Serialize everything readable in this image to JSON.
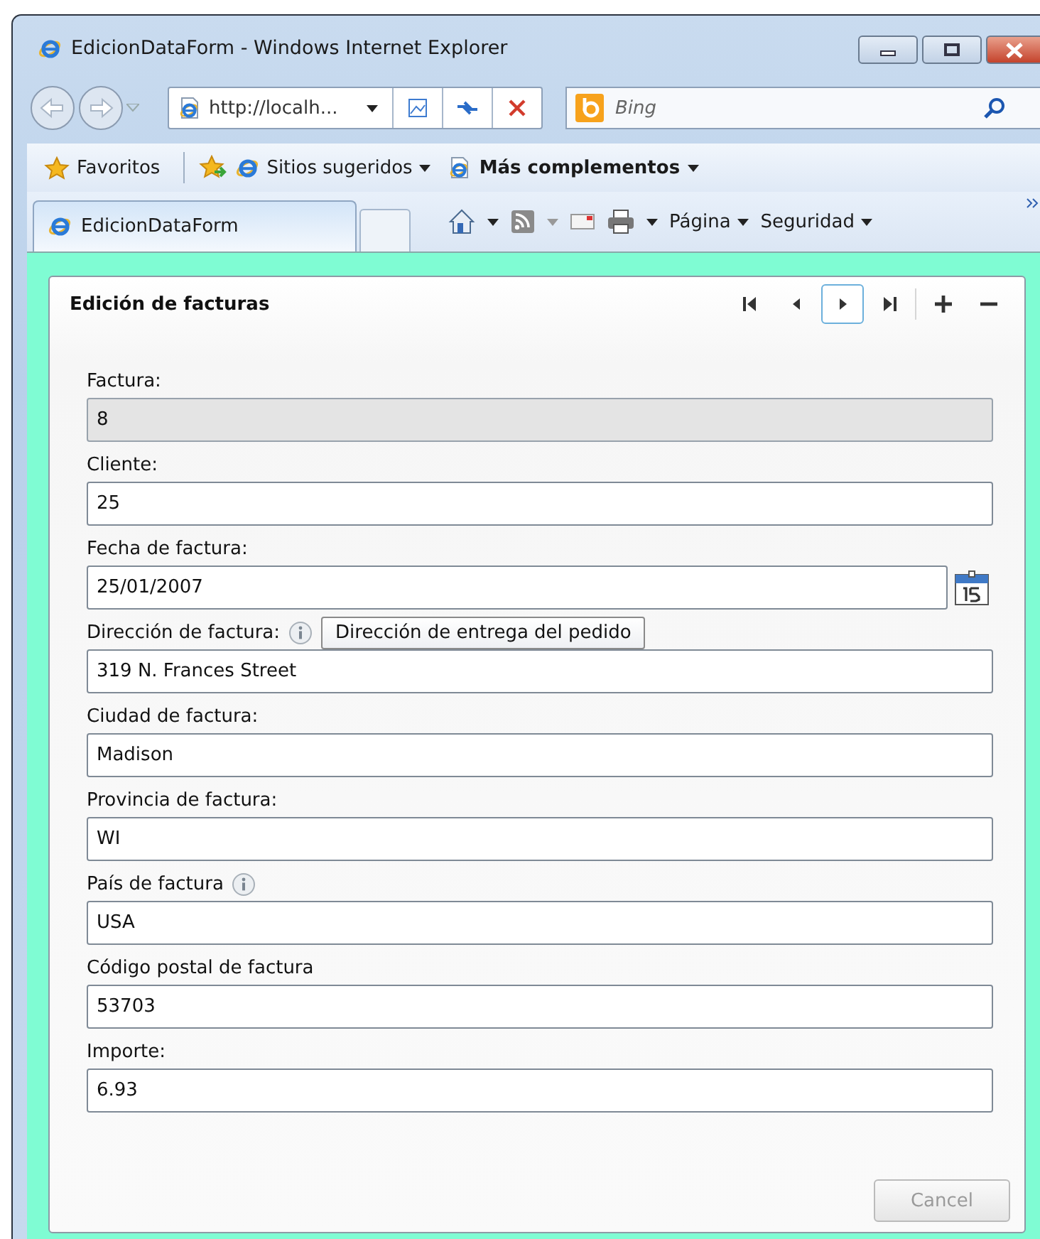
{
  "window": {
    "title": "EdicionDataForm - Windows Internet Explorer"
  },
  "address_bar": {
    "url": "http://localh..."
  },
  "search": {
    "placeholder": "Bing"
  },
  "favorites_bar": {
    "items": [
      {
        "label": "Favoritos",
        "kind": "favorites",
        "bold": false
      },
      {
        "label": "Sitios sugeridos",
        "kind": "suggested",
        "bold": false
      },
      {
        "label": "Más complementos",
        "kind": "addons",
        "bold": true
      }
    ]
  },
  "tabs": [
    {
      "label": "EdicionDataForm",
      "selected": true
    }
  ],
  "command_bar": {
    "items": [
      {
        "label": "Página"
      },
      {
        "label": "Seguridad"
      }
    ]
  },
  "form": {
    "title": "Edición de facturas",
    "navigation": [
      {
        "kind": "first",
        "focused": false
      },
      {
        "kind": "previous",
        "focused": false
      },
      {
        "kind": "next",
        "focused": true
      },
      {
        "kind": "last",
        "focused": false
      },
      {
        "kind": "add",
        "focused": false
      },
      {
        "kind": "delete",
        "focused": false
      }
    ],
    "fields": [
      {
        "label": "Factura:",
        "value": "8",
        "kind": "text",
        "readonly": true,
        "info": false
      },
      {
        "label": "Cliente:",
        "value": "25",
        "kind": "text",
        "readonly": false,
        "info": false
      },
      {
        "label": "Fecha de factura:",
        "value": "25/01/2007",
        "kind": "date",
        "readonly": false,
        "info": false
      },
      {
        "label": "Dirección de factura:",
        "value": "319 N. Frances Street",
        "kind": "text",
        "readonly": false,
        "info": true,
        "tooltip": "Dirección de entrega del pedido"
      },
      {
        "label": "Ciudad de factura:",
        "value": "Madison",
        "kind": "text",
        "readonly": false,
        "info": false
      },
      {
        "label": "Provincia de factura:",
        "value": "WI",
        "kind": "text",
        "readonly": false,
        "info": false
      },
      {
        "label": "País de factura",
        "value": "USA",
        "kind": "text",
        "readonly": false,
        "info": true
      },
      {
        "label": "Código postal de factura",
        "value": "53703",
        "kind": "text",
        "readonly": false,
        "info": false
      },
      {
        "label": "Importe:",
        "value": "6.93",
        "kind": "text",
        "readonly": false,
        "info": false
      }
    ],
    "cancel_button": {
      "label": "Cancel",
      "disabled": true
    }
  }
}
